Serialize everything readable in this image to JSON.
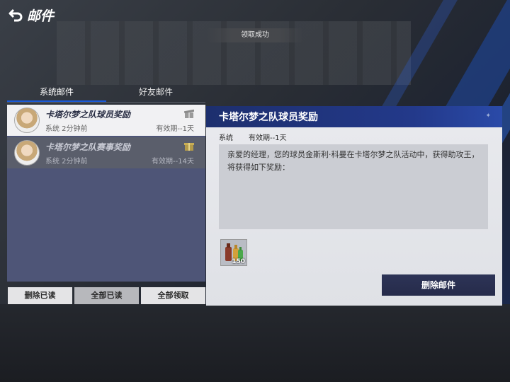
{
  "header": {
    "title": "邮件"
  },
  "toast": {
    "text": "领取成功"
  },
  "tabs": [
    {
      "label": "系统邮件"
    },
    {
      "label": "好友邮件"
    }
  ],
  "mail_list": [
    {
      "title": "卡塔尔梦之队球员奖励",
      "sender_time": "系统 2分钟前",
      "expiry": "有效期--1天"
    },
    {
      "title": "卡塔尔梦之队赛事奖励",
      "sender_time": "系统 2分钟前",
      "expiry": "有效期--14天"
    }
  ],
  "buttons": {
    "delete_read": "删除已读",
    "mark_all_read": "全部已读",
    "claim_all": "全部领取"
  },
  "detail": {
    "title": "卡塔尔梦之队球员奖励",
    "sender": "系统",
    "expiry": "有效期--1天",
    "body": "亲爱的经理，您的球员金斯利·科曼在卡塔尔梦之队活动中，获得助攻王，将获得如下奖励：",
    "reward_qty": "150",
    "delete_button": "删除邮件"
  },
  "colors": {
    "accent": "#1a5ad8",
    "header": "#1d2f6e"
  }
}
